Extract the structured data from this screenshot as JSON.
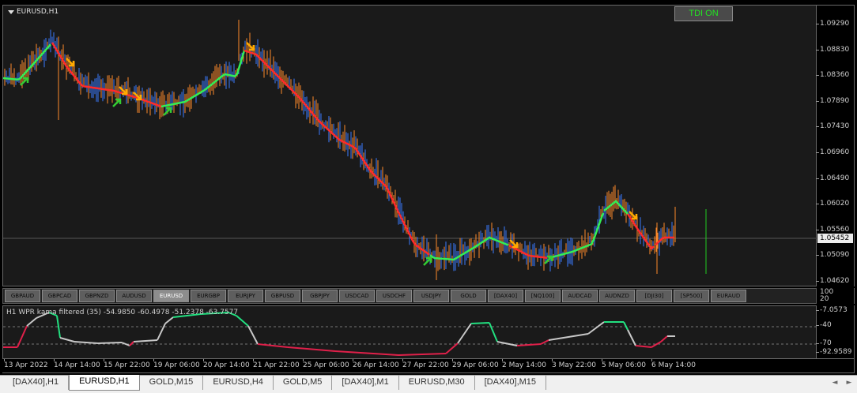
{
  "chart": {
    "title": "EURUSD,H1",
    "tdi_button": "TDI ON",
    "current_price": "1.05452",
    "price_ticks": [
      "1.09290",
      "1.08830",
      "1.08360",
      "1.07890",
      "1.07430",
      "1.06960",
      "1.06490",
      "1.06020",
      "1.05560",
      "1.05090",
      "1.04620"
    ],
    "symbol_buttons": [
      "GBPAUD",
      "GBPCAD",
      "GBPNZD",
      "AUDUSD",
      "EURUSD",
      "EURGBP",
      "EURJPY",
      "GBPUSD",
      "GBPJPY",
      "USDCAD",
      "USDCHF",
      "USDJPY",
      "GOLD",
      "[DAX40]",
      "[NQ100]",
      "AUDCAD",
      "AUDNZD",
      "[DJI30]",
      "[SP500]",
      "EURAUD"
    ],
    "active_symbol": "EURUSD",
    "strip_ticks": [
      "100",
      "20"
    ],
    "indicator": {
      "label": "H1  WPR kama filtered (35) -54.9850 -60.4978 -51.2378 -63.7577",
      "ticks": [
        "-7.0573",
        "-40",
        "-70",
        "-92.9589"
      ]
    },
    "time_ticks": [
      "13 Apr 2022",
      "14 Apr 14:00",
      "15 Apr 22:00",
      "19 Apr 06:00",
      "20 Apr 14:00",
      "21 Apr 22:00",
      "25 Apr 06:00",
      "26 Apr 14:00",
      "27 Apr 22:00",
      "29 Apr 06:00",
      "2 May 14:00",
      "3 May 22:00",
      "5 May 06:00",
      "6 May 14:00"
    ],
    "colors": {
      "bull": "#3b7bff",
      "bear": "#ff8a2a",
      "up_line": "#33ee55",
      "down_line": "#ff2a2a",
      "signal_up": "#33cc33",
      "signal_down": "#ffaa00"
    }
  },
  "tabs": [
    "[DAX40],H1",
    "EURUSD,H1",
    "GOLD,M15",
    "EURUSD,H4",
    "GOLD,M5",
    "[DAX40],M1",
    "EURUSD,M30",
    "[DAX40],M15"
  ],
  "active_tab": "EURUSD,H1",
  "tab_scroll": {
    "left": "◄",
    "right": "►"
  }
}
